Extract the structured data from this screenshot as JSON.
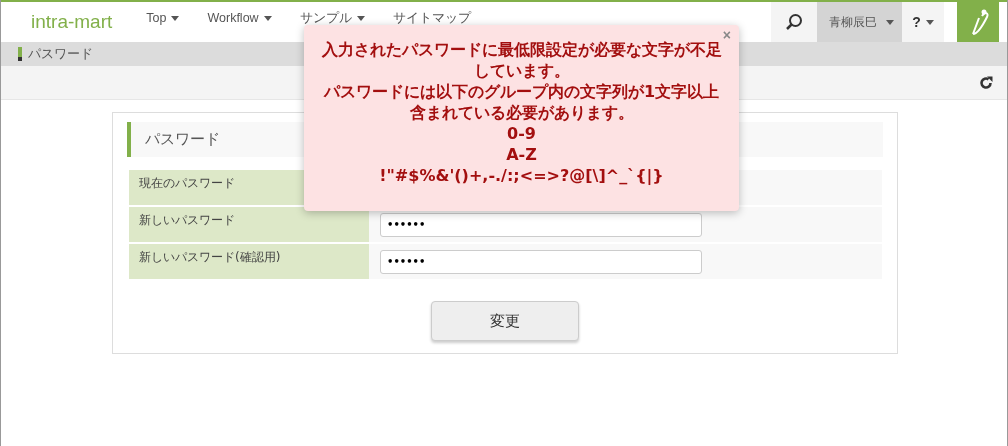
{
  "header": {
    "logo": "intra-mart",
    "menu": [
      {
        "label": "Top",
        "dropdown": true
      },
      {
        "label": "Workflow",
        "dropdown": true
      },
      {
        "label": "サンプル",
        "dropdown": true
      },
      {
        "label": "サイトマップ",
        "dropdown": false
      }
    ],
    "user": "青柳辰巳",
    "help": "?"
  },
  "breadcrumb": "パスワード",
  "panel": {
    "title": "パスワード",
    "rows": [
      {
        "label": "現在のパスワード"
      },
      {
        "label": "新しいパスワード",
        "value": "••••••"
      },
      {
        "label": "新しいパスワード(確認用)",
        "value": "••••••"
      }
    ],
    "button": "変更"
  },
  "alert": {
    "close": "×",
    "lines": [
      "入力されたパスワードに最低限設定が必要な文字が不足しています。",
      "パスワードには以下のグループ内の文字列が1文字以上含まれている必要があります。",
      "0-9",
      "A-Z",
      "!\"#$%&'()+,-./:;<=>?@[\\]^_`{|}"
    ]
  }
}
